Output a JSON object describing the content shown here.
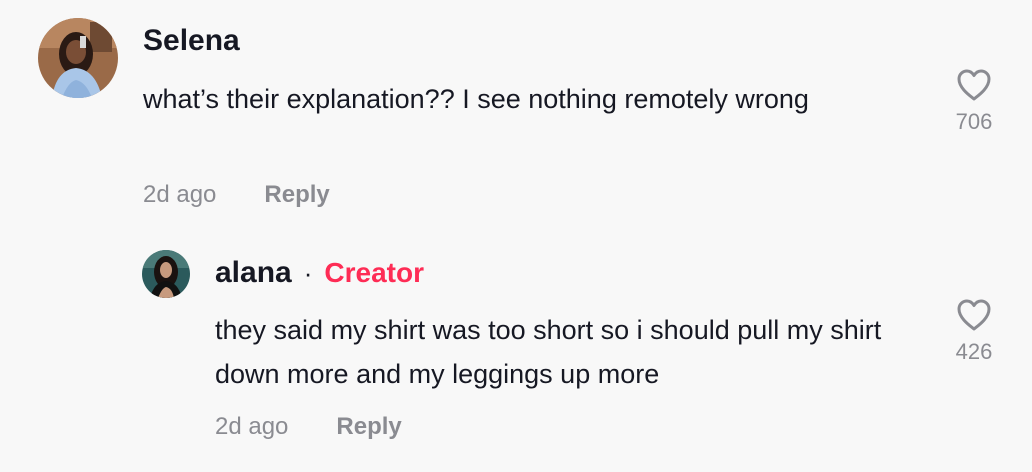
{
  "comments": [
    {
      "username": "Selena",
      "text": "what’s their explanation?? I see nothing remotely wrong",
      "time": "2d ago",
      "reply_label": "Reply",
      "like_count": "706",
      "like_icon": "heart-outline-icon"
    },
    {
      "username": "alana",
      "separator": "·",
      "badge": "Creator",
      "text": "they said my shirt was too short so i should pull my shirt down more and my leggings up more",
      "time": "2d ago",
      "reply_label": "Reply",
      "like_count": "426",
      "like_icon": "heart-outline-icon"
    }
  ],
  "colors": {
    "background": "#f8f8f8",
    "text_primary": "#161823",
    "text_secondary": "#8a8b91",
    "creator_badge": "#fe2c55"
  }
}
